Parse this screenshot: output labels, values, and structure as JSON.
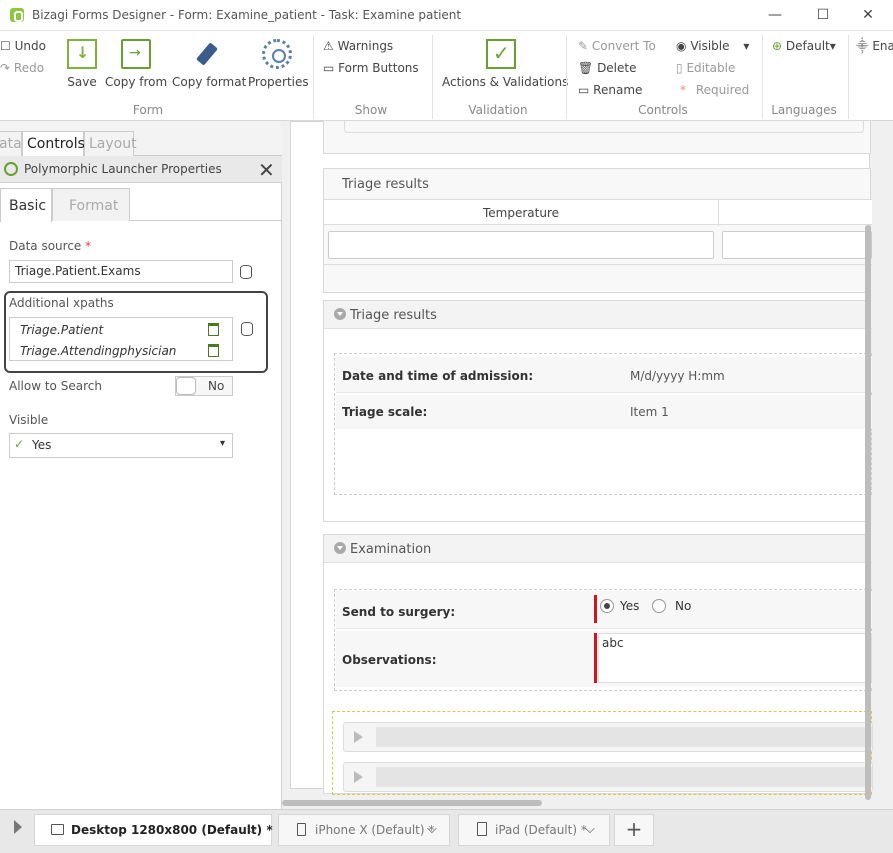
{
  "window": {
    "title": "Bizagi Forms Designer  - Form: Examine_patient - Task:  Examine patient",
    "minimize": "—",
    "maximize": "☐",
    "close": "✕"
  },
  "ribbon": {
    "undo": "Undo",
    "redo": "Redo",
    "save": "Save",
    "copy_from": "Copy from",
    "copy_format": "Copy format",
    "properties": "Properties",
    "form_group": "Form",
    "warnings": "Warnings",
    "form_buttons": "Form Buttons",
    "show_group": "Show",
    "actions_validations": "Actions & Validations",
    "validation_group": "Validation",
    "convert_to": "Convert To",
    "delete": "Delete",
    "rename": "Rename",
    "visible": "Visible",
    "editable": "Editable",
    "required": "Required",
    "controls_group": "Controls",
    "language": "Default",
    "languages_group": "Languages",
    "overflow_text": "Ena"
  },
  "left_panel": {
    "tabs": [
      "ata",
      "Controls",
      "Layout"
    ],
    "props_title": "Polymorphic Launcher Properties",
    "inner_tabs": [
      "Basic",
      "Format"
    ],
    "data_source_label": "Data source",
    "required_mark": "*",
    "data_source_value": "Triage.Patient.Exams",
    "additional_xpaths_label": "Additional xpaths",
    "xpaths": [
      "Triage.Patient",
      "Triage.Attendingphysician"
    ],
    "allow_search_label": "Allow to Search",
    "allow_search_value": "No",
    "visible_label": "Visible",
    "visible_value": "Yes"
  },
  "canvas": {
    "grid_section_title": "Triage results",
    "grid_column": "Temperature",
    "group1_title": "Triage results",
    "admission_label": "Date and time of admission:",
    "admission_value": "M/d/yyyy H:mm",
    "triage_scale_label": "Triage scale:",
    "triage_scale_value": "Item 1",
    "group2_title": "Examination",
    "surgery_label": "Send to surgery:",
    "yes": "Yes",
    "no": "No",
    "observations_label": "Observations:",
    "observations_value": "abc"
  },
  "devices": [
    {
      "label": "Desktop 1280x800 (Default)",
      "star": "*"
    },
    {
      "label": "iPhone X (Default)",
      "star": "*"
    },
    {
      "label": "iPad (Default)",
      "star": "*"
    }
  ],
  "add_device": "+",
  "colors": {
    "brand_green": "#8dc63f",
    "required_red": "#d2141e"
  }
}
